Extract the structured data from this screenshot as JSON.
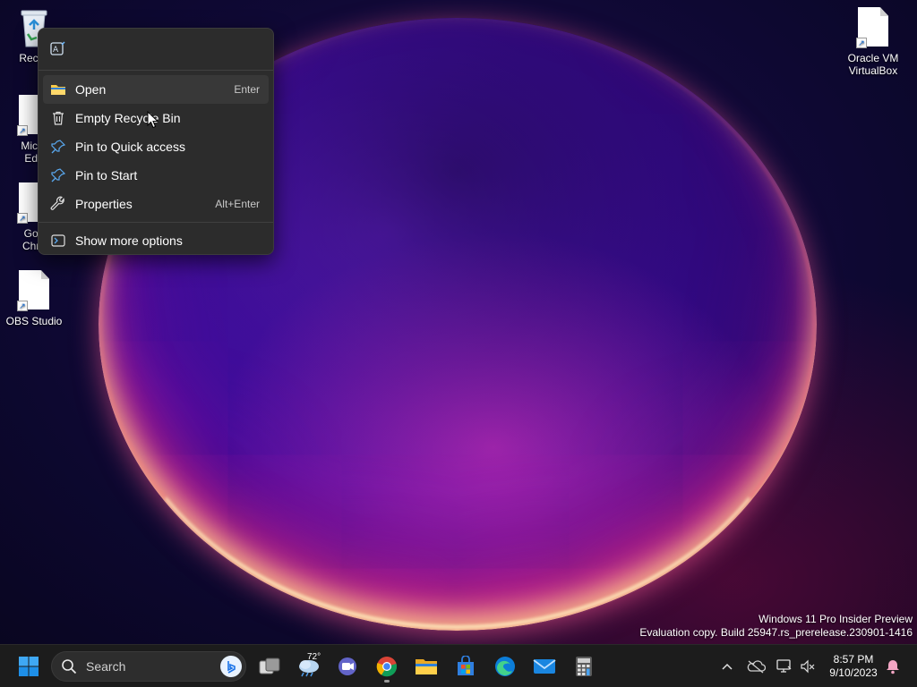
{
  "desktop": {
    "icons": [
      {
        "label": "Recyc",
        "icon": "recycle-bin-icon"
      },
      {
        "label": "Micro Edg",
        "icon": "edge-shortcut-icon"
      },
      {
        "label": "Goo Chro",
        "icon": "chrome-shortcut-icon"
      },
      {
        "label": "OBS Studio",
        "icon": "file-shortcut-icon"
      },
      {
        "label": "Oracle VM VirtualBox",
        "icon": "file-shortcut-icon"
      }
    ],
    "icon_lines": {
      "recycle": [
        "Recyc"
      ],
      "edge": [
        "Micro",
        "Edg"
      ],
      "chrome": [
        "Goo",
        "Chro"
      ],
      "obs": [
        "OBS Studio"
      ],
      "vbox": [
        "Oracle VM",
        "VirtualBox"
      ]
    }
  },
  "context_menu": {
    "top_icon": "ai-rewrite-icon",
    "items": [
      {
        "label": "Open",
        "shortcut": "Enter",
        "icon": "folder-icon",
        "highlighted": true
      },
      {
        "label": "Empty Recycle Bin",
        "shortcut": "",
        "icon": "trash-icon"
      },
      {
        "label": "Pin to Quick access",
        "shortcut": "",
        "icon": "pin-icon"
      },
      {
        "label": "Pin to Start",
        "shortcut": "",
        "icon": "pin-icon"
      },
      {
        "label": "Properties",
        "shortcut": "Alt+Enter",
        "icon": "wrench-icon"
      },
      {
        "label": "Show more options",
        "shortcut": "",
        "icon": "more-options-icon"
      }
    ]
  },
  "watermark": {
    "line1": "Windows 11 Pro Insider Preview",
    "line2": "Evaluation copy. Build 25947.rs_prerelease.230901-1416"
  },
  "taskbar": {
    "search_placeholder": "Search",
    "weather_temp": "72°",
    "apps": [
      "start",
      "search",
      "task-view",
      "weather",
      "teams-chat",
      "chrome",
      "file-explorer",
      "microsoft-store",
      "edge",
      "mail",
      "calculator"
    ],
    "clock": {
      "time": "8:57 PM",
      "date": "9/10/2023"
    }
  },
  "colors": {
    "menu_bg": "#2c2c2c",
    "taskbar_bg": "#1c1c1c",
    "accent_blue": "#0a84ff"
  }
}
